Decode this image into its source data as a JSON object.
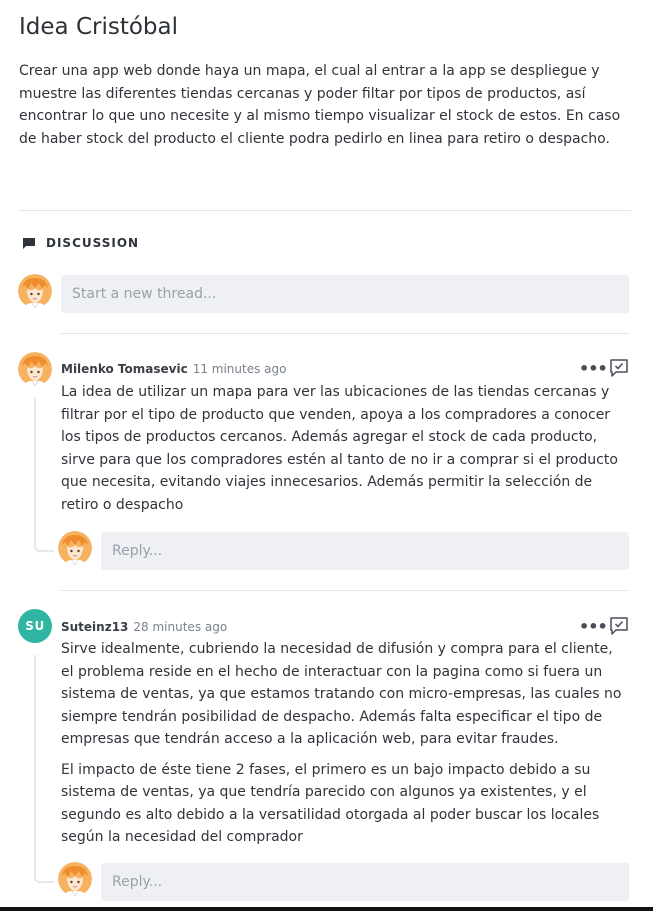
{
  "idea": {
    "title": "Idea Cristóbal",
    "description": "Crear una app web donde haya un mapa, el cual al entrar a la app se despliegue y muestre las diferentes tiendas cercanas y poder filtar por tipos de productos, así encontrar lo que uno necesite y al mismo tiempo visualizar el stock de estos. En caso de haber stock del producto el cliente podra pedirlo en linea para retiro o despacho."
  },
  "discussion": {
    "heading": "DISCUSSION",
    "icon": "comment-icon",
    "new_thread_placeholder": "Start a new thread..."
  },
  "comments": [
    {
      "author": "Milenko Tomasevic",
      "time": "11 minutes ago",
      "avatar": "anime-avatar",
      "paragraphs": [
        "La idea de utilizar un mapa para ver las ubicaciones de las tiendas cercanas y filtrar por el tipo de producto que venden, apoya a los compradores a conocer los tipos de productos cercanos. Además agregar el stock de cada producto, sirve para que los compradores estén al tanto de no ir a comprar si el producto que necesita, evitando viajes innecesarios. Además permitir la selección de retiro o despacho"
      ],
      "more_label": "•••",
      "reply_placeholder": "Reply..."
    },
    {
      "author": "Suteinz13",
      "time": "28 minutes ago",
      "avatar_initials": "SU",
      "avatar_color": "#2fb5a1",
      "paragraphs": [
        "Sirve idealmente, cubriendo la necesidad de difusión y compra para el cliente, el problema reside en el hecho de interactuar con la pagina como si fuera un sistema de ventas, ya que estamos tratando con micro-empresas, las cuales no siempre tendrán posibilidad de despacho. Además falta especificar el tipo de empresas que tendrán acceso a la aplicación web, para evitar fraudes.",
        "El impacto de éste tiene 2 fases, el primero es un bajo impacto debido a su sistema de ventas, ya que tendría parecido con algunos ya existentes, y el segundo es alto debido a la versatilidad otorgada al poder buscar los locales según la necesidad del comprador"
      ],
      "more_label": "•••",
      "reply_placeholder": "Reply..."
    }
  ]
}
